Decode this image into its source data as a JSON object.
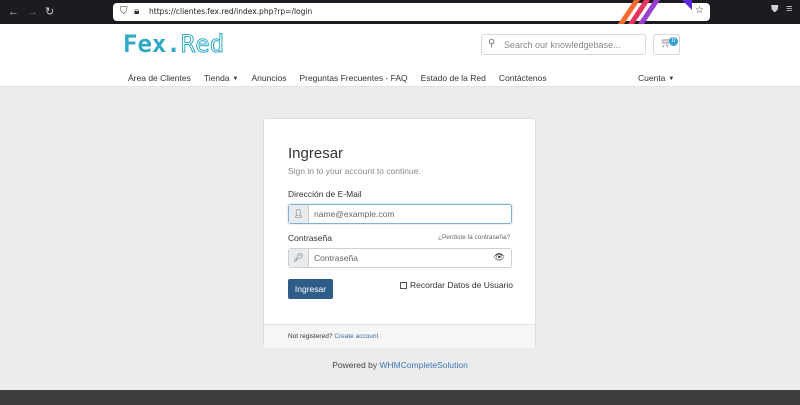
{
  "browser": {
    "url": "https://clientes.fex.red/index.php?rp=/login"
  },
  "header": {
    "logo_left": "Fex.",
    "logo_right": "Red",
    "search_placeholder": "Search our knowledgebase...",
    "cart_count": "0",
    "nav": [
      "Área de Clientes",
      "Tienda",
      "Anuncios",
      "Preguntas Frecuentes - FAQ",
      "Estado de la Red",
      "Contáctenos"
    ],
    "account": "Cuenta"
  },
  "login": {
    "title": "Ingresar",
    "subtitle": "Sign in to your account to continue.",
    "email_label": "Dirección de E-Mail",
    "email_placeholder": "name@example.com",
    "password_label": "Contraseña",
    "forgot": "¿Perdiste la contraseña?",
    "password_placeholder": "Contraseña",
    "submit": "Ingresar",
    "remember": "Recordar Datos de Usuario",
    "not_registered": "Not registered?",
    "create_account": "Create account"
  },
  "footer": {
    "powered_by": "Powered by",
    "powered_link": "WHMCompleteSolution"
  },
  "colors": {
    "brand": "#2fa9c6",
    "button": "#2f5d8a",
    "link": "#3a78b8"
  }
}
